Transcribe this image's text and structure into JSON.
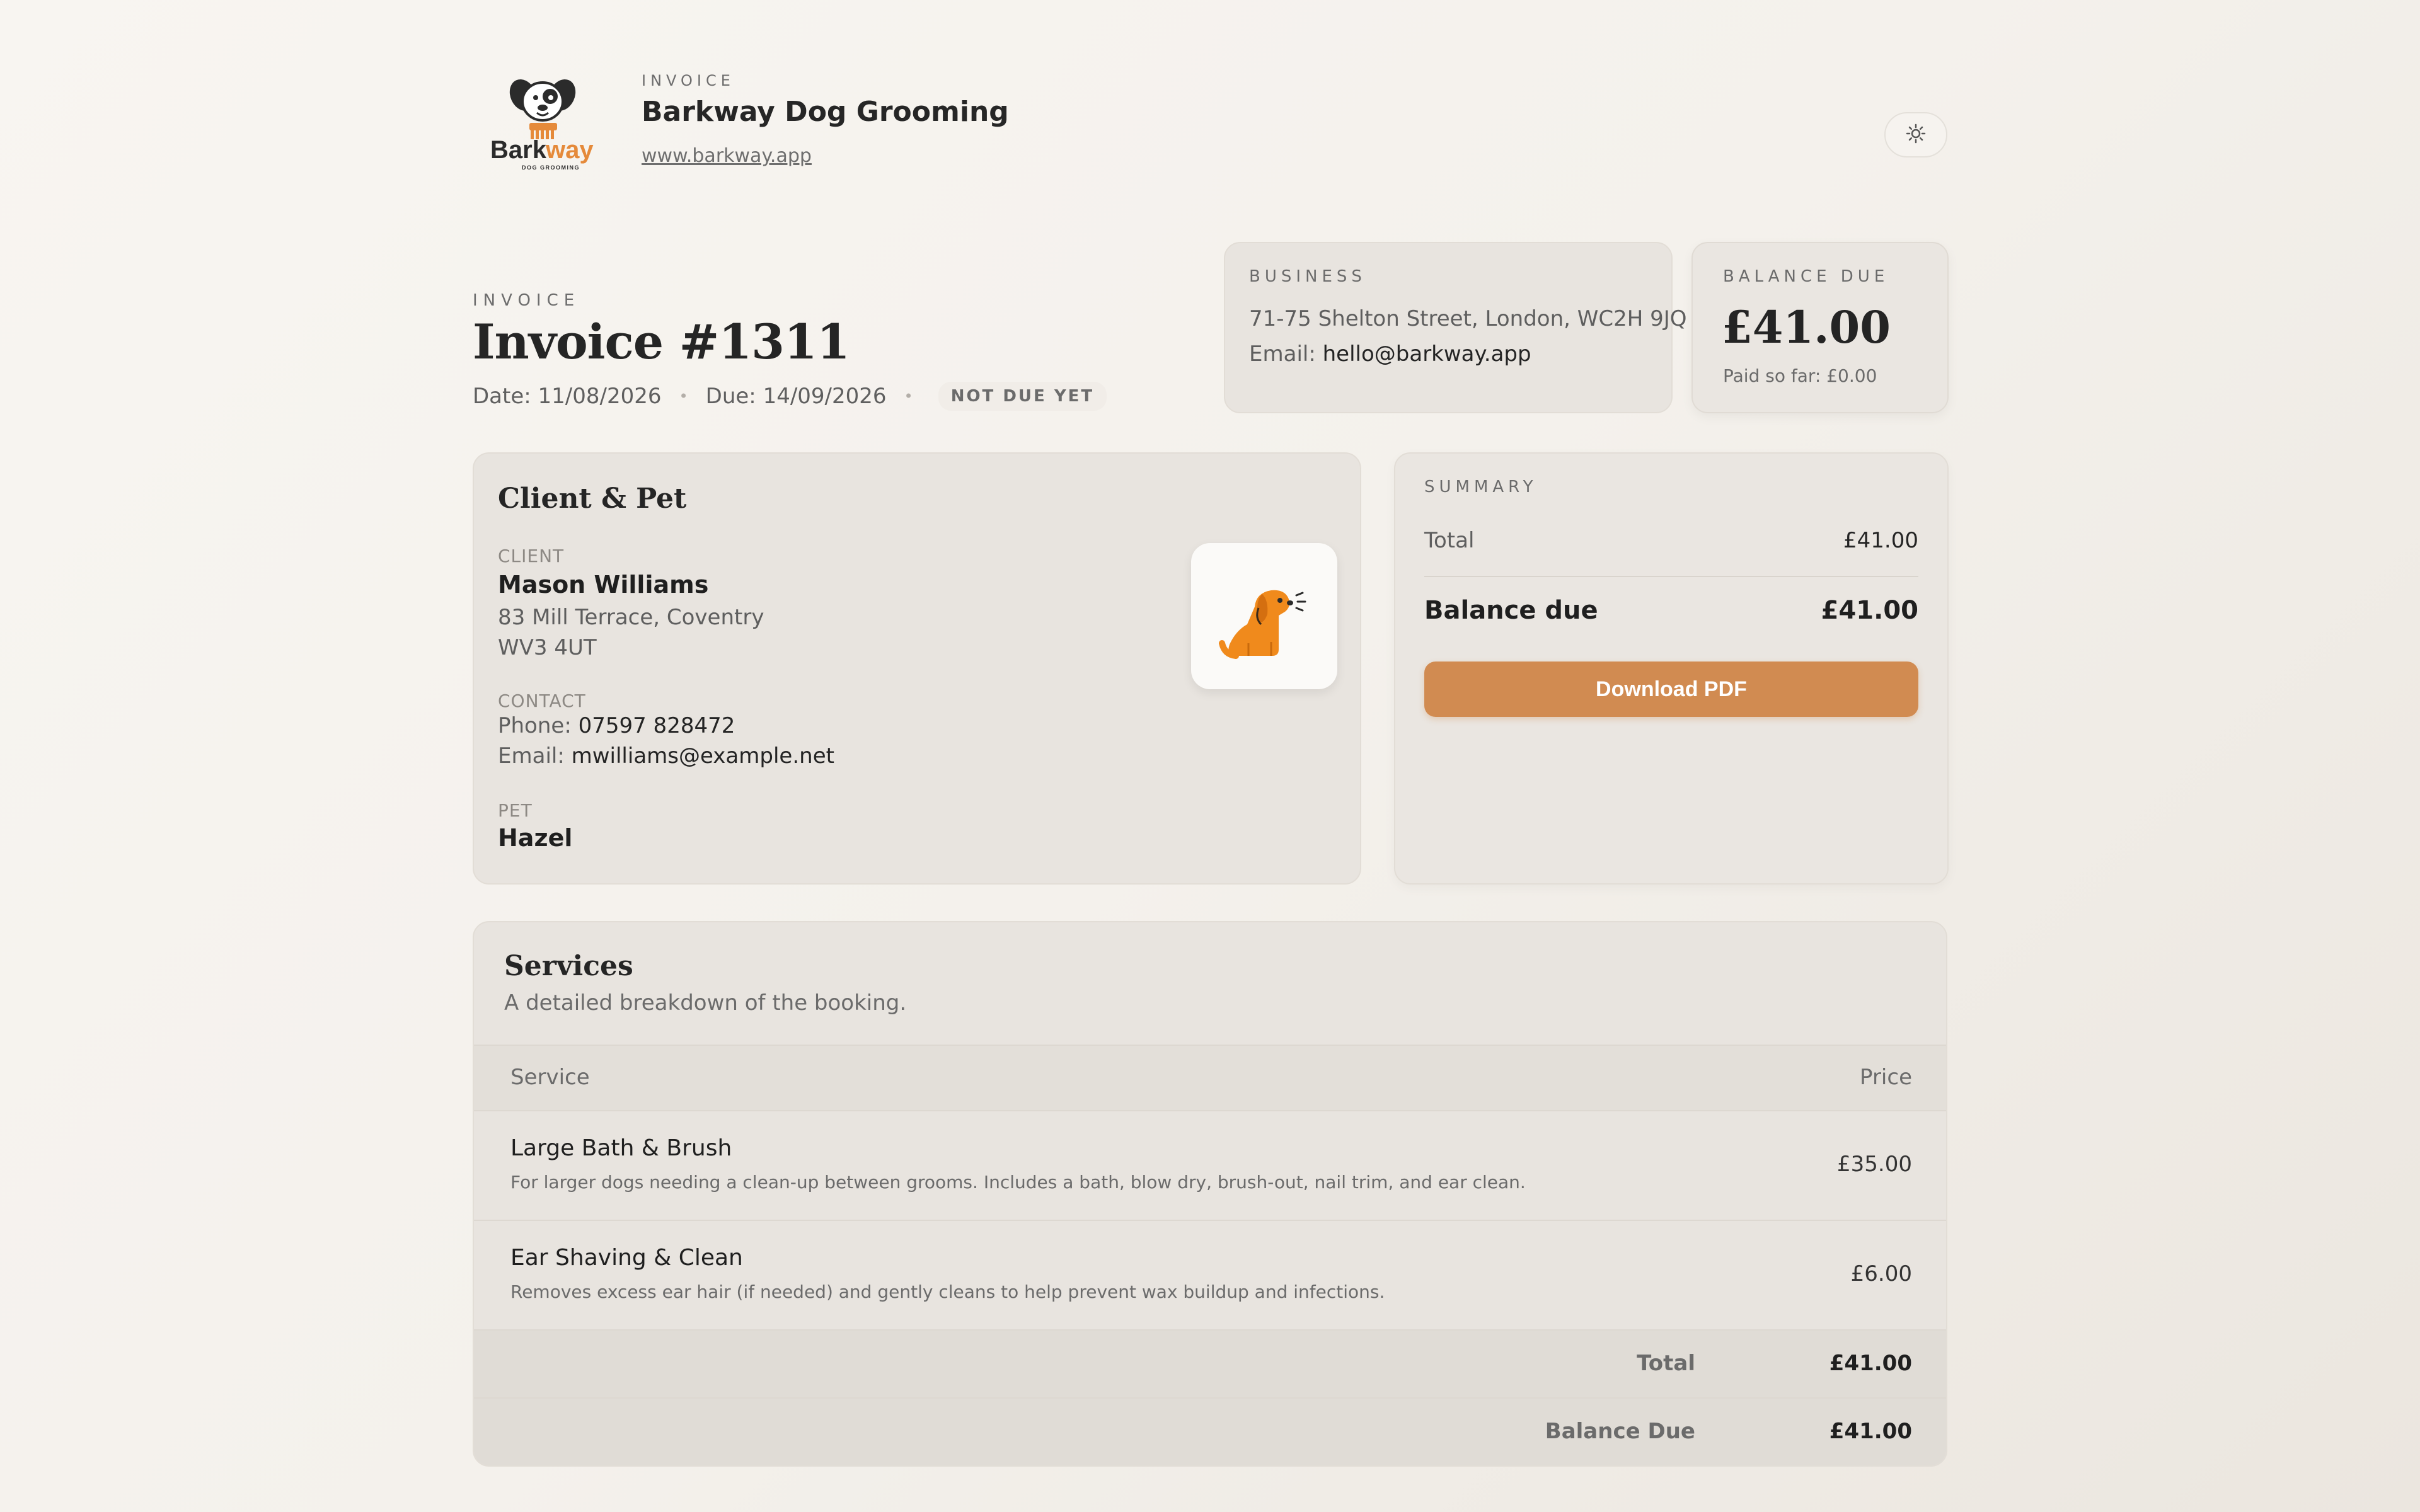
{
  "header": {
    "eyebrow": "INVOICE",
    "business_name": "Barkway Dog Grooming",
    "website": "www.barkway.app",
    "logo": {
      "text_main": "Bark",
      "text_accent": "way",
      "tagline": "DOG GROOMING",
      "accent_color": "#e58a3a"
    },
    "theme_toggle_icon": "sun-icon"
  },
  "invoice": {
    "eyebrow": "INVOICE",
    "title": "Invoice #1311",
    "date": "Date: 11/08/2026",
    "due": "Due: 14/09/2026",
    "status": "NOT DUE YET"
  },
  "business": {
    "eyebrow": "BUSINESS",
    "address": "71-75 Shelton Street, London, WC2H 9JQ",
    "email_label": "Email:",
    "email": "hello@barkway.app"
  },
  "balance": {
    "eyebrow": "BALANCE DUE",
    "amount": "£41.00",
    "paid": "Paid so far: £0.00"
  },
  "client_pet": {
    "title": "Client & Pet",
    "client_label": "CLIENT",
    "client_name": "Mason Williams",
    "address_line1": "83 Mill Terrace, Coventry",
    "address_line2": "WV3 4UT",
    "contact_label": "CONTACT",
    "phone_label": "Phone:",
    "phone": "07597 828472",
    "email_label": "Email:",
    "email": "mwilliams@example.net",
    "pet_label": "PET",
    "pet_name": "Hazel",
    "pet_icon": "dog-icon",
    "pet_color": "#f08a1c"
  },
  "summary": {
    "eyebrow": "SUMMARY",
    "total_label": "Total",
    "total": "£41.00",
    "balance_label": "Balance due",
    "balance": "£41.00",
    "download_label": "Download PDF",
    "button_color": "#d18b51"
  },
  "services": {
    "title": "Services",
    "subtitle": "A detailed breakdown of the booking.",
    "columns": {
      "service": "Service",
      "price": "Price"
    },
    "items": [
      {
        "name": "Large Bath & Brush",
        "desc": "For larger dogs needing a clean-up between grooms. Includes a bath, blow dry, brush-out, nail trim, and ear clean.",
        "price": "£35.00"
      },
      {
        "name": "Ear Shaving & Clean",
        "desc": "Removes excess ear hair (if needed) and gently cleans to help prevent wax buildup and infections.",
        "price": "£6.00"
      }
    ],
    "total_label": "Total",
    "total": "£41.00",
    "balance_label": "Balance Due",
    "balance": "£41.00"
  }
}
